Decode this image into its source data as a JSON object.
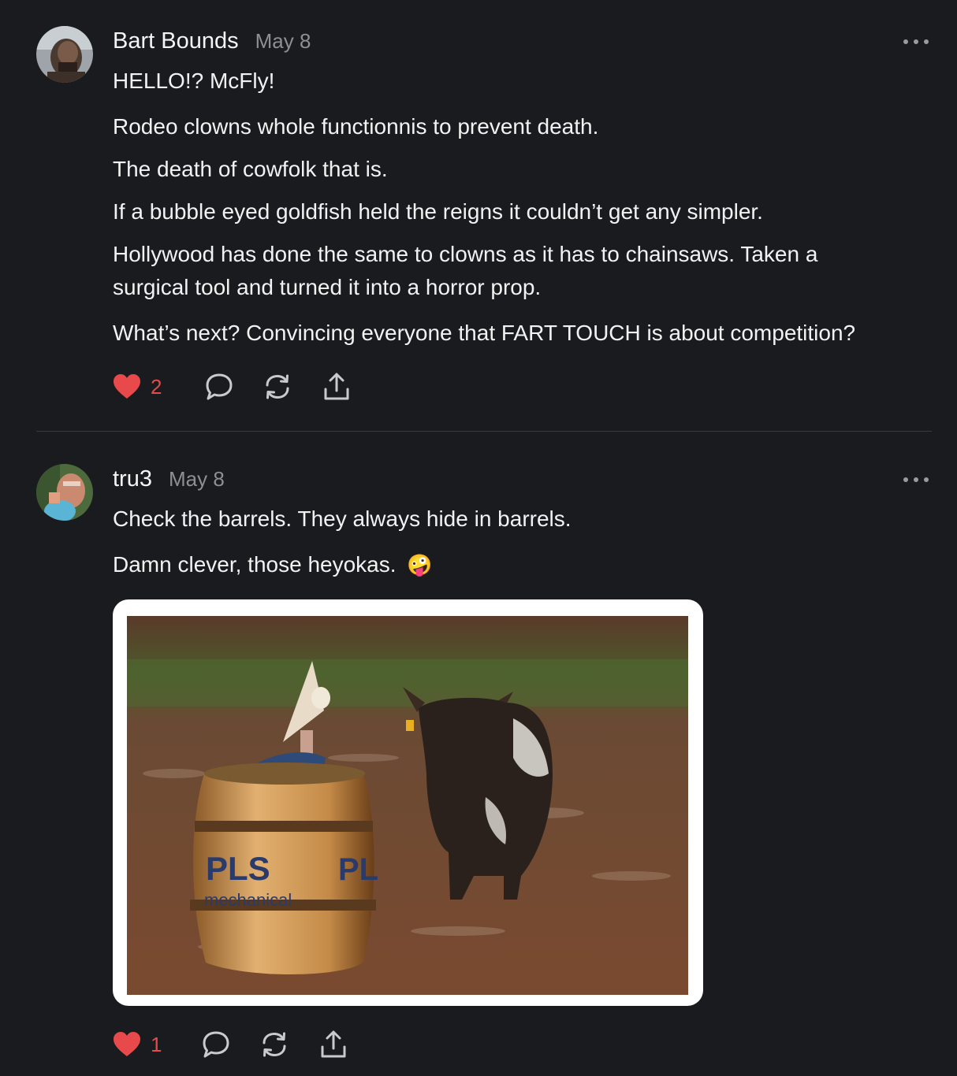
{
  "posts": [
    {
      "author": "Bart Bounds",
      "date": "May 8",
      "paragraphs": [
        "HELLO!? McFly!",
        "Rodeo clowns whole functionnis to prevent death.",
        "The death of cowfolk that is.",
        "If a bubble eyed goldfish held the reigns it couldn’t get any simpler.",
        "Hollywood has done the same to clowns as it has to chainsaws. Taken a",
        "surgical tool and turned it into a horror prop.",
        "What’s next? Convincing everyone that FART TOUCH is about competition?"
      ],
      "likes": "2",
      "icons": [
        "heart-icon",
        "comment-icon",
        "repost-icon",
        "share-icon",
        "more-icon"
      ]
    },
    {
      "author": "tru3",
      "date": "May 8",
      "paragraphs": [
        "Check the barrels. They always hide in barrels.",
        "Damn clever, those heyokas."
      ],
      "emoji": "🤪",
      "image_text": {
        "barrel_logo": "PLS",
        "barrel_sub": "mechanical",
        "barrel_right": "PL"
      },
      "likes": "1",
      "icons": [
        "heart-icon",
        "comment-icon",
        "repost-icon",
        "share-icon",
        "more-icon"
      ]
    }
  ],
  "colors": {
    "background": "#1a1b1e",
    "like": "#e8494a",
    "muted": "#8e8f94",
    "icon": "#c9cacf"
  }
}
